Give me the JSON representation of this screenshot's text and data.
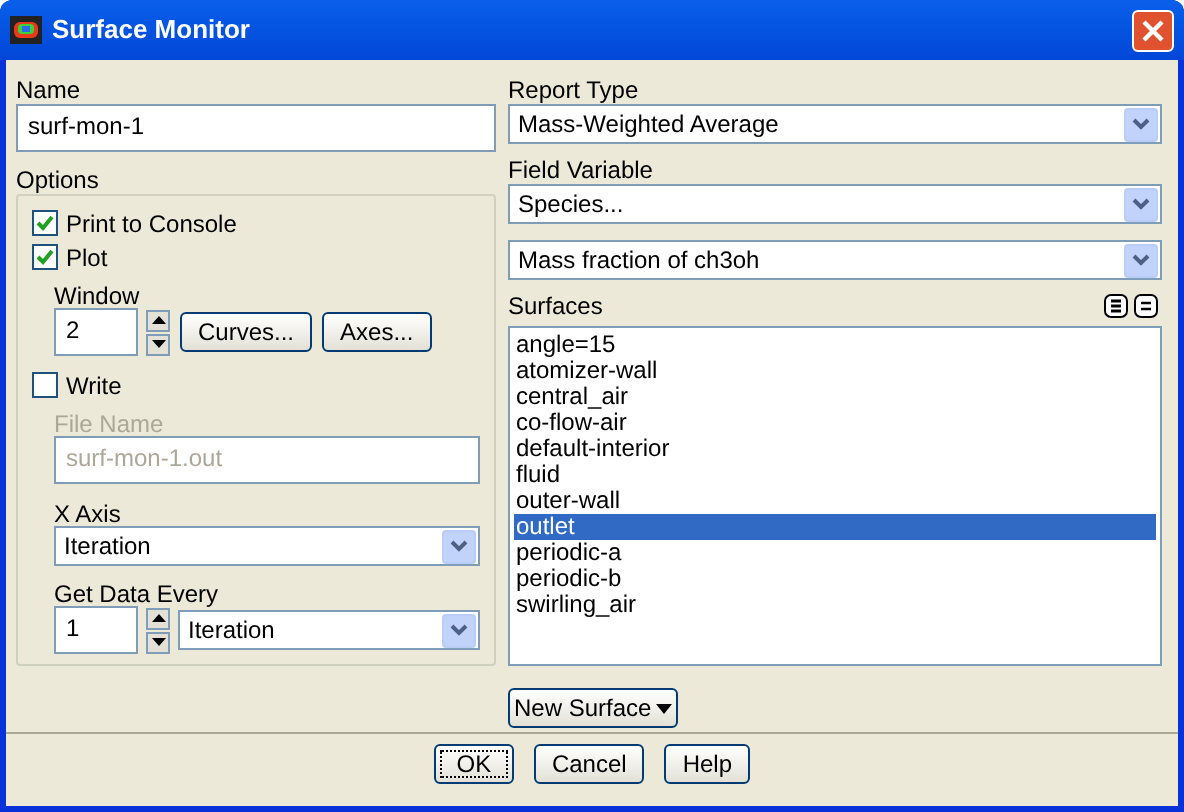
{
  "window": {
    "title": "Surface Monitor"
  },
  "name": {
    "label": "Name",
    "value": "surf-mon-1"
  },
  "options": {
    "label": "Options",
    "checkboxes": [
      {
        "label": "Print to Console",
        "checked": true
      },
      {
        "label": "Plot",
        "checked": true
      }
    ],
    "window_field": {
      "label": "Window",
      "value": "2"
    },
    "plot_buttons": [
      "Curves...",
      "Axes..."
    ],
    "write": {
      "label": "Write",
      "checked": false
    },
    "file_name": {
      "label": "File Name",
      "value": "surf-mon-1.out",
      "disabled": true
    },
    "x_axis": {
      "label": "X Axis",
      "value": "Iteration"
    },
    "get_data_every": {
      "label": "Get Data Every",
      "value": "1",
      "unit": "Iteration"
    }
  },
  "report_type": {
    "label": "Report Type",
    "value": "Mass-Weighted Average"
  },
  "field_variable": {
    "label": "Field Variable",
    "values": [
      "Species...",
      "Mass fraction of ch3oh"
    ]
  },
  "surfaces": {
    "label": "Surfaces",
    "items": [
      {
        "label": "angle=15",
        "selected": false
      },
      {
        "label": "atomizer-wall",
        "selected": false
      },
      {
        "label": "central_air",
        "selected": false
      },
      {
        "label": "co-flow-air",
        "selected": false
      },
      {
        "label": "default-interior",
        "selected": false
      },
      {
        "label": "fluid",
        "selected": false
      },
      {
        "label": "outer-wall",
        "selected": false
      },
      {
        "label": "outlet",
        "selected": true
      },
      {
        "label": "periodic-a",
        "selected": false
      },
      {
        "label": "periodic-b",
        "selected": false
      },
      {
        "label": "swirling_air",
        "selected": false
      }
    ]
  },
  "new_surface_button": "New Surface",
  "buttons": [
    "OK",
    "Cancel",
    "Help"
  ]
}
